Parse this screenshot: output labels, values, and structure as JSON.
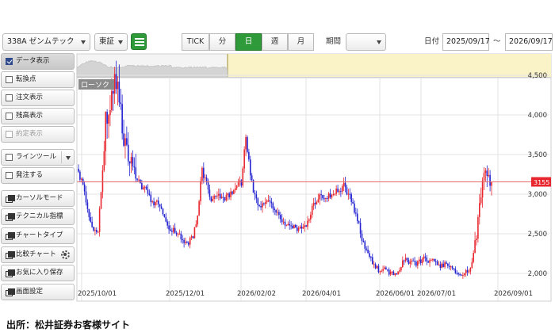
{
  "toolbar": {
    "symbol": "338A ゼンムテック",
    "exchange": "東証",
    "timeframes": [
      "TICK",
      "分",
      "日",
      "週",
      "月"
    ],
    "active_timeframe": "日",
    "period_label": "期間",
    "period_value": "",
    "date_label": "日付",
    "date_from": "2025/09/17",
    "date_sep": "～",
    "date_to": "2026/09/17"
  },
  "left_panel": {
    "items": [
      {
        "label": "データ表示",
        "icon": "checkbox-checked-icon",
        "checked": true
      },
      {
        "label": "転換点",
        "icon": "checkbox-icon",
        "checked": false
      },
      {
        "label": "注文表示",
        "icon": "checkbox-icon",
        "checked": false
      },
      {
        "label": "残高表示",
        "icon": "checkbox-icon",
        "checked": false
      },
      {
        "label": "約定表示",
        "icon": "checkbox-icon",
        "checked": false,
        "disabled": true
      },
      {
        "label": "ラインツール",
        "icon": "checkbox-icon",
        "checked": false,
        "dropdown": true
      },
      {
        "label": "発注する",
        "icon": "checkbox-icon",
        "checked": false
      },
      {
        "label": "カーソルモード",
        "icon": "window-icon"
      },
      {
        "label": "テクニカル指標",
        "icon": "window-icon"
      },
      {
        "label": "チャートタイプ",
        "icon": "window-icon"
      },
      {
        "label": "比較チャート",
        "icon": "window-icon",
        "settings": true
      },
      {
        "label": "お気に入り保存",
        "icon": "window-icon"
      },
      {
        "label": "画面設定",
        "icon": "window-icon"
      }
    ]
  },
  "source": "出所：松井証券お客様サイト",
  "chart_data": {
    "type": "candlestick",
    "series_label": "ローソク",
    "x_tick_labels": [
      "2025/10/01",
      "2025/12/01",
      "2026/02/02",
      "2026/04/01",
      "2026/06/01",
      "2026/07/01",
      "2026/09/01"
    ],
    "y_tick_labels": [
      "2,000",
      "2,500",
      "3,000",
      "3,500",
      "4,000",
      "4,500"
    ],
    "ylim": [
      1850,
      4700
    ],
    "current_price": 3155,
    "current_price_label": "3155",
    "colors": {
      "up": "#e8262d",
      "down": "#2323d2",
      "price_line": "#e86a6a",
      "price_tag": "#e8262d",
      "navigator_window": "#fbf3c8"
    },
    "grid": true,
    "close_path": [
      [
        0,
        3280
      ],
      [
        3,
        3150
      ],
      [
        7,
        2700
      ],
      [
        10,
        2550
      ],
      [
        13,
        2520
      ],
      [
        16,
        3300
      ],
      [
        18,
        3900
      ],
      [
        21,
        4100
      ],
      [
        24,
        4450
      ],
      [
        27,
        4200
      ],
      [
        30,
        3700
      ],
      [
        34,
        3400
      ],
      [
        38,
        3200
      ],
      [
        42,
        3100
      ],
      [
        46,
        3000
      ],
      [
        50,
        2900
      ],
      [
        54,
        2850
      ],
      [
        58,
        2650
      ],
      [
        62,
        2550
      ],
      [
        66,
        2500
      ],
      [
        70,
        2420
      ],
      [
        73,
        2400
      ],
      [
        76,
        2480
      ],
      [
        79,
        2750
      ],
      [
        82,
        3300
      ],
      [
        85,
        3100
      ],
      [
        88,
        2900
      ],
      [
        92,
        2980
      ],
      [
        96,
        2950
      ],
      [
        100,
        3000
      ],
      [
        104,
        3050
      ],
      [
        108,
        3150
      ],
      [
        111,
        3700
      ],
      [
        113,
        3400
      ],
      [
        116,
        3050
      ],
      [
        120,
        2850
      ],
      [
        124,
        2950
      ],
      [
        128,
        2850
      ],
      [
        132,
        2750
      ],
      [
        136,
        2650
      ],
      [
        140,
        2600
      ],
      [
        144,
        2580
      ],
      [
        148,
        2550
      ],
      [
        152,
        2620
      ],
      [
        156,
        2900
      ],
      [
        160,
        2980
      ],
      [
        164,
        3000
      ],
      [
        168,
        2980
      ],
      [
        172,
        3050
      ],
      [
        176,
        3100
      ],
      [
        180,
        2950
      ],
      [
        184,
        2750
      ],
      [
        188,
        2450
      ],
      [
        192,
        2250
      ],
      [
        196,
        2100
      ],
      [
        200,
        2030
      ],
      [
        204,
        2050
      ],
      [
        208,
        1990
      ],
      [
        212,
        2020
      ],
      [
        216,
        2180
      ],
      [
        220,
        2150
      ],
      [
        224,
        2120
      ],
      [
        228,
        2180
      ],
      [
        232,
        2160
      ],
      [
        236,
        2140
      ],
      [
        240,
        2100
      ],
      [
        244,
        2110
      ],
      [
        248,
        2050
      ],
      [
        252,
        1980
      ],
      [
        256,
        2020
      ],
      [
        260,
        2050
      ],
      [
        264,
        2450
      ],
      [
        267,
        3000
      ],
      [
        270,
        3400
      ],
      [
        272,
        3180
      ],
      [
        274,
        3155
      ]
    ]
  }
}
